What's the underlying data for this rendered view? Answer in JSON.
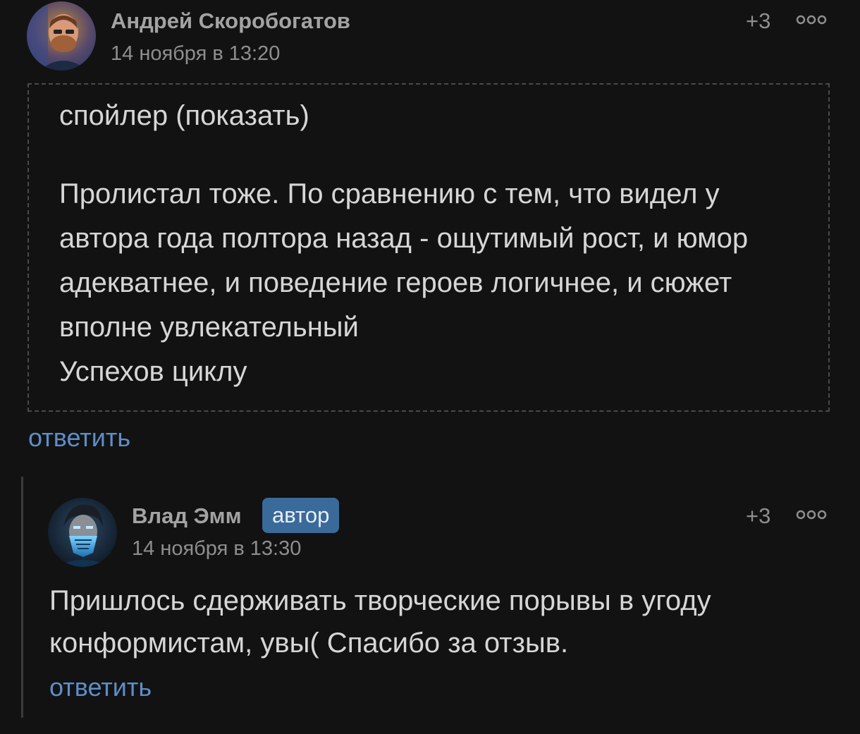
{
  "comments": [
    {
      "author": "Андрей Скоробогатов",
      "timestamp": "14 ноября в 13:20",
      "rating": "+3",
      "spoiler_label": "спойлер (показать)",
      "text_lines": [
        "Пролистал тоже. По сравнению с тем, что видел у",
        "автора года полтора назад - ощутимый рост, и юмор",
        "адекватнее, и поведение героев логичнее, и сюжет",
        "вполне увлекательный",
        "Успехов циклу"
      ],
      "reply_label": "ответить",
      "menu_icon": "more-dots-icon"
    },
    {
      "author": "Влад Эмм",
      "badge": "автор",
      "timestamp": "14 ноября в 13:30",
      "rating": "+3",
      "text_lines": [
        "Пришлось сдерживать творческие порывы в угоду",
        "конформистам, увы( Спасибо за отзыв."
      ],
      "reply_label": "ответить",
      "menu_icon": "more-dots-icon"
    }
  ],
  "colors": {
    "background": "#121212",
    "text": "#d6d6d6",
    "muted": "#8e8e8e",
    "link": "#5d8ec9",
    "badge": "#3a6a9a",
    "spoiler_border": "#4a4a4a"
  }
}
